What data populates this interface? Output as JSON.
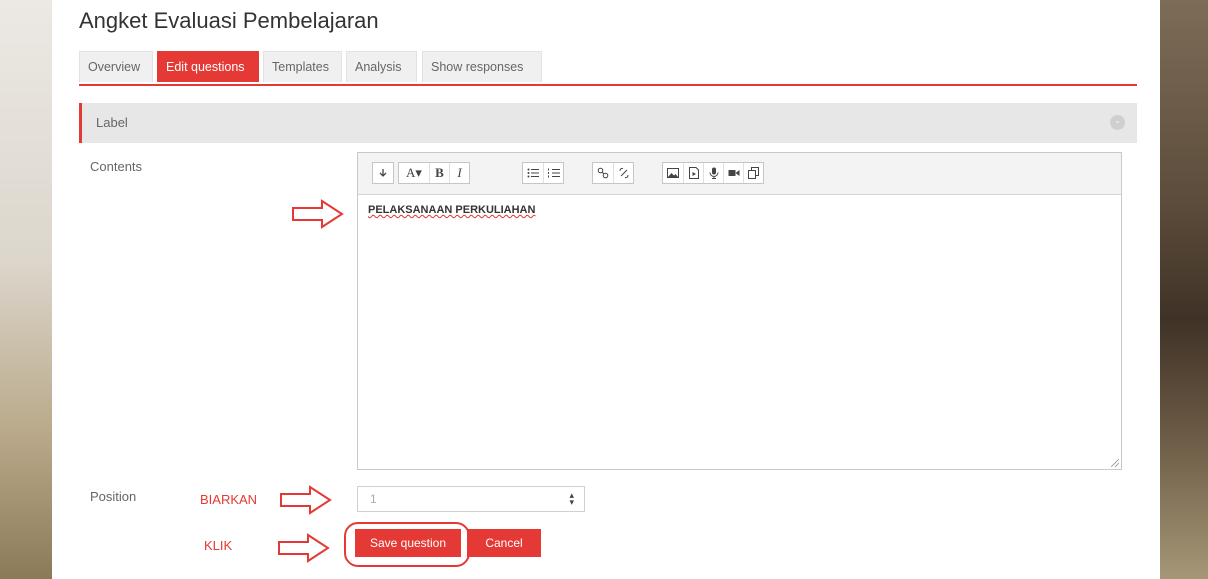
{
  "page": {
    "title": "Angket Evaluasi Pembelajaran"
  },
  "tabs": [
    {
      "label": "Overview",
      "active": false
    },
    {
      "label": "Edit questions",
      "active": true
    },
    {
      "label": "Templates",
      "active": false
    },
    {
      "label": "Analysis",
      "active": false
    },
    {
      "label": "Show responses",
      "active": false
    }
  ],
  "section": {
    "label": "Label"
  },
  "form": {
    "contents_label": "Contents",
    "editor_text": "PELAKSANAAN PERKULIAHAN",
    "position_label": "Position",
    "position_value": "1",
    "save_label": "Save question",
    "cancel_label": "Cancel"
  },
  "toolbar": {
    "groups": [
      [
        "collapse-icon"
      ],
      [
        "text-style-icon",
        "bold-icon",
        "italic-icon"
      ],
      [
        "unordered-list-icon",
        "ordered-list-icon"
      ],
      [
        "link-icon",
        "unlink-icon"
      ],
      [
        "image-icon",
        "media-icon",
        "record-audio-icon",
        "record-video-icon",
        "manage-files-icon"
      ]
    ]
  },
  "annotations": {
    "biarkan": "BIARKAN",
    "klik": "KLIK"
  },
  "colors": {
    "accent": "#e53935"
  }
}
